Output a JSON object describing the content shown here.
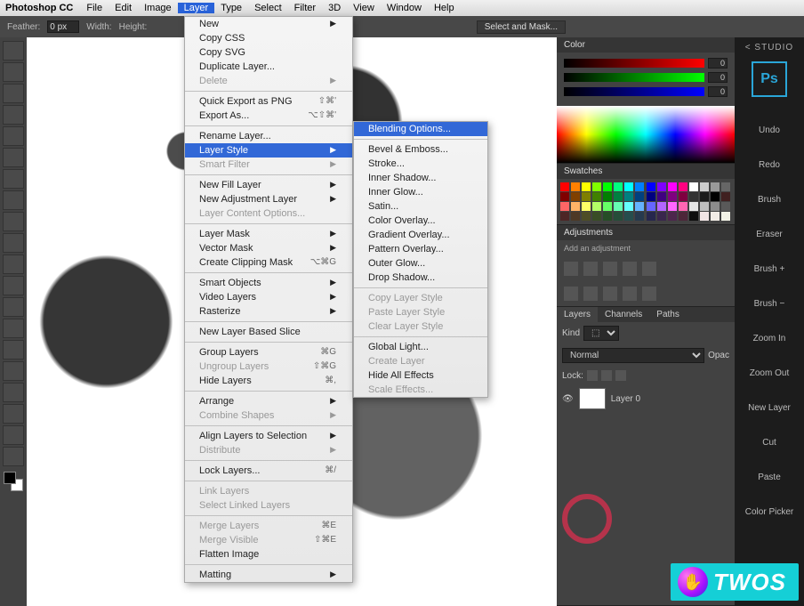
{
  "menubar": {
    "app": "Photoshop CC",
    "items": [
      "File",
      "Edit",
      "Image",
      "Layer",
      "Type",
      "Select",
      "Filter",
      "3D",
      "View",
      "Window",
      "Help"
    ],
    "active": "Layer"
  },
  "optionsbar": {
    "feather_label": "Feather:",
    "feather_value": "0 px",
    "width_label": "Width:",
    "height_label": "Height:",
    "select_mask": "Select and Mask..."
  },
  "layer_menu": [
    {
      "label": "New",
      "arrow": true
    },
    {
      "label": "Copy CSS"
    },
    {
      "label": "Copy SVG"
    },
    {
      "label": "Duplicate Layer..."
    },
    {
      "label": "Delete",
      "disabled": true,
      "arrow": true
    },
    {
      "sep": true
    },
    {
      "label": "Quick Export as PNG",
      "shortcut": "⇧⌘'"
    },
    {
      "label": "Export As...",
      "shortcut": "⌥⇧⌘'"
    },
    {
      "sep": true
    },
    {
      "label": "Rename Layer..."
    },
    {
      "label": "Layer Style",
      "arrow": true,
      "highlight": true
    },
    {
      "label": "Smart Filter",
      "disabled": true,
      "arrow": true
    },
    {
      "sep": true
    },
    {
      "label": "New Fill Layer",
      "arrow": true
    },
    {
      "label": "New Adjustment Layer",
      "arrow": true
    },
    {
      "label": "Layer Content Options...",
      "disabled": true
    },
    {
      "sep": true
    },
    {
      "label": "Layer Mask",
      "arrow": true
    },
    {
      "label": "Vector Mask",
      "arrow": true
    },
    {
      "label": "Create Clipping Mask",
      "shortcut": "⌥⌘G"
    },
    {
      "sep": true
    },
    {
      "label": "Smart Objects",
      "arrow": true
    },
    {
      "label": "Video Layers",
      "arrow": true
    },
    {
      "label": "Rasterize",
      "arrow": true
    },
    {
      "sep": true
    },
    {
      "label": "New Layer Based Slice"
    },
    {
      "sep": true
    },
    {
      "label": "Group Layers",
      "shortcut": "⌘G"
    },
    {
      "label": "Ungroup Layers",
      "shortcut": "⇧⌘G",
      "disabled": true
    },
    {
      "label": "Hide Layers",
      "shortcut": "⌘,"
    },
    {
      "sep": true
    },
    {
      "label": "Arrange",
      "arrow": true
    },
    {
      "label": "Combine Shapes",
      "disabled": true,
      "arrow": true
    },
    {
      "sep": true
    },
    {
      "label": "Align Layers to Selection",
      "arrow": true
    },
    {
      "label": "Distribute",
      "disabled": true,
      "arrow": true
    },
    {
      "sep": true
    },
    {
      "label": "Lock Layers...",
      "shortcut": "⌘/"
    },
    {
      "sep": true
    },
    {
      "label": "Link Layers",
      "disabled": true
    },
    {
      "label": "Select Linked Layers",
      "disabled": true
    },
    {
      "sep": true
    },
    {
      "label": "Merge Layers",
      "shortcut": "⌘E",
      "disabled": true
    },
    {
      "label": "Merge Visible",
      "shortcut": "⇧⌘E",
      "disabled": true
    },
    {
      "label": "Flatten Image"
    },
    {
      "sep": true
    },
    {
      "label": "Matting",
      "arrow": true
    }
  ],
  "style_menu": [
    {
      "label": "Blending Options...",
      "highlight": true
    },
    {
      "sep": true
    },
    {
      "label": "Bevel & Emboss..."
    },
    {
      "label": "Stroke..."
    },
    {
      "label": "Inner Shadow..."
    },
    {
      "label": "Inner Glow..."
    },
    {
      "label": "Satin..."
    },
    {
      "label": "Color Overlay..."
    },
    {
      "label": "Gradient Overlay..."
    },
    {
      "label": "Pattern Overlay..."
    },
    {
      "label": "Outer Glow..."
    },
    {
      "label": "Drop Shadow..."
    },
    {
      "sep": true
    },
    {
      "label": "Copy Layer Style",
      "disabled": true
    },
    {
      "label": "Paste Layer Style",
      "disabled": true
    },
    {
      "label": "Clear Layer Style",
      "disabled": true
    },
    {
      "sep": true
    },
    {
      "label": "Global Light..."
    },
    {
      "label": "Create Layer",
      "disabled": true
    },
    {
      "label": "Hide All Effects"
    },
    {
      "label": "Scale Effects...",
      "disabled": true
    }
  ],
  "panels": {
    "color": {
      "tab": "Color",
      "r": "0",
      "g": "0",
      "b": "0"
    },
    "swatches": {
      "tab": "Swatches"
    },
    "adjustments": {
      "tab": "Adjustments",
      "hint": "Add an adjustment"
    },
    "layers": {
      "tabs": [
        "Layers",
        "Channels",
        "Paths"
      ],
      "kind_label": "Kind",
      "blend": "Normal",
      "opacity_label": "Opac",
      "lock_label": "Lock:",
      "layer0": "Layer 0"
    }
  },
  "studio": {
    "title": "< STUDIO",
    "badge": "Ps",
    "items": [
      "Undo",
      "Redo",
      "Brush",
      "Eraser",
      "Brush +",
      "Brush −",
      "Zoom In",
      "Zoom Out",
      "New Layer",
      "Cut",
      "Paste",
      "Color Picker"
    ]
  },
  "swatch_colors": [
    "#ff0000",
    "#ff8000",
    "#ffff00",
    "#80ff00",
    "#00ff00",
    "#00ff80",
    "#00ffff",
    "#0080ff",
    "#0000ff",
    "#8000ff",
    "#ff00ff",
    "#ff0080",
    "#ffffff",
    "#cccccc",
    "#999999",
    "#666666",
    "#800000",
    "#804000",
    "#808000",
    "#408000",
    "#008000",
    "#008040",
    "#008080",
    "#004080",
    "#000080",
    "#400080",
    "#800080",
    "#800040",
    "#333333",
    "#1a1a1a",
    "#000000",
    "#402020",
    "#ff6666",
    "#ffb366",
    "#ffff66",
    "#b3ff66",
    "#66ff66",
    "#66ffb3",
    "#66ffff",
    "#66b3ff",
    "#6666ff",
    "#b366ff",
    "#ff66ff",
    "#ff66b3",
    "#e6e6e6",
    "#bfbfbf",
    "#8c8c8c",
    "#595959",
    "#4d2626",
    "#4d3926",
    "#4d4d26",
    "#394d26",
    "#264d26",
    "#264d39",
    "#264d4d",
    "#26394d",
    "#26264d",
    "#39264d",
    "#4d264d",
    "#4d2639",
    "#0d0d0d",
    "#f2e6e6",
    "#f2ece6",
    "#f2f2e6"
  ],
  "watermark": {
    "text": "TWOS"
  }
}
